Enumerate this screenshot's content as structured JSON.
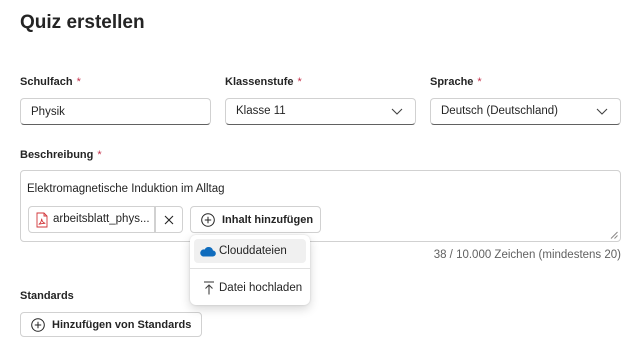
{
  "page": {
    "title": "Quiz erstellen"
  },
  "fields": {
    "subject": {
      "label": "Schulfach",
      "required_mark": "*",
      "value": "Physik"
    },
    "grade": {
      "label": "Klassenstufe",
      "required_mark": "*",
      "value": "Klasse 11",
      "icon": "chevron-down-icon"
    },
    "language": {
      "label": "Sprache",
      "required_mark": "*",
      "value": "Deutsch (Deutschland)",
      "icon": "chevron-down-icon"
    }
  },
  "description": {
    "label": "Beschreibung",
    "required_mark": "*",
    "text": "Elektromagnetische Induktion im Alltag",
    "attachment": {
      "name": "arbeitsblatt_phys...",
      "icon": "pdf-file-icon",
      "remove_icon": "close-icon"
    },
    "add_content": {
      "label": "Inhalt hinzufügen",
      "icon": "add-circle-icon"
    },
    "char_count": "38 / 10.000 Zeichen (mindestens 20)"
  },
  "add_menu": {
    "items": [
      {
        "label": "Clouddateien",
        "icon": "cloud-icon",
        "highlighted": true
      },
      {
        "label": "Datei hochladen",
        "icon": "upload-icon",
        "highlighted": false
      }
    ]
  },
  "standards": {
    "label": "Standards",
    "add_button": {
      "label": "Hinzufügen von Standards",
      "icon": "add-circle-icon"
    }
  },
  "colors": {
    "text": "#242424",
    "muted": "#616161",
    "required": "#c4314b",
    "cloud": "#0f6cbd",
    "pdf": "#d13438"
  }
}
